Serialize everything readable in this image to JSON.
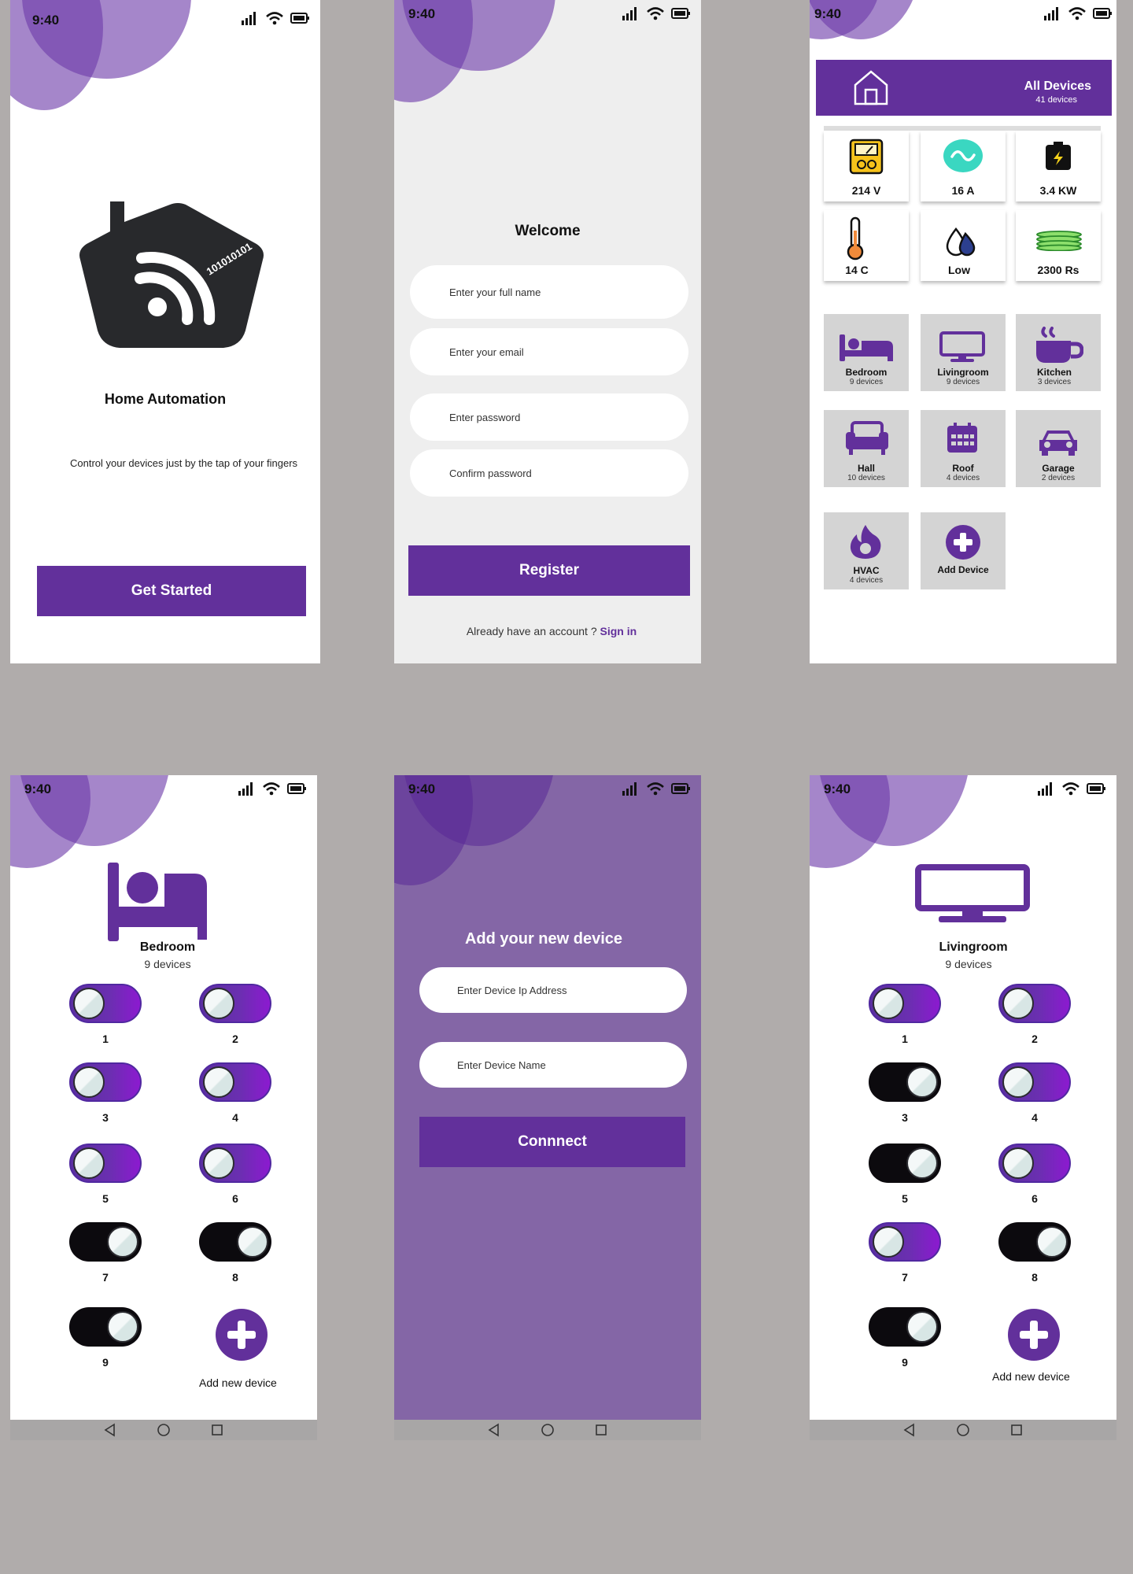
{
  "status_time": "9:40",
  "colors": {
    "accent": "#62309b",
    "toggle_on": "#6a2fb0",
    "toggle_off": "#0c0a0e",
    "background": "#b0acab",
    "light_screen": "#eeeeee",
    "purple_screen": "#8466a6"
  },
  "splash": {
    "title": "Home Automation",
    "subtitle": "Control your devices just by the tap of your fingers",
    "binary_text": "101010101",
    "cta": "Get Started"
  },
  "register": {
    "title": "Welcome",
    "full_name_placeholder": "Enter your full name",
    "email_placeholder": "Enter your email",
    "password_placeholder": "Enter password",
    "confirm_placeholder": "Confirm password",
    "submit": "Register",
    "signin_prompt": "Already have an account ?",
    "signin_link": "Sign in"
  },
  "dashboard": {
    "header_title": "All Devices",
    "header_count": "41 devices",
    "stats": [
      {
        "icon": "voltmeter-icon",
        "value": "214 V"
      },
      {
        "icon": "ac-current-icon",
        "value": "16 A"
      },
      {
        "icon": "battery-icon",
        "value": "3.4 KW"
      },
      {
        "icon": "thermometer-icon",
        "value": "14 C"
      },
      {
        "icon": "water-level-icon",
        "value": "Low"
      },
      {
        "icon": "money-icon",
        "value": "2300 Rs"
      }
    ],
    "rooms": [
      {
        "icon": "bed-icon",
        "name": "Bedroom",
        "count": "9 devices"
      },
      {
        "icon": "tv-icon",
        "name": "Livingroom",
        "count": "9 devices"
      },
      {
        "icon": "cup-icon",
        "name": "Kitchen",
        "count": "3 devices"
      },
      {
        "icon": "sofa-icon",
        "name": "Hall",
        "count": "10 devices"
      },
      {
        "icon": "calendar-icon",
        "name": "Roof",
        "count": "4 devices"
      },
      {
        "icon": "car-icon",
        "name": "Garage",
        "count": "2 devices"
      },
      {
        "icon": "flame-icon",
        "name": "HVAC",
        "count": "4 devices"
      },
      {
        "icon": "plus-icon",
        "name": "Add Device",
        "count": ""
      }
    ]
  },
  "bedroom": {
    "title": "Bedroom",
    "count": "9 devices",
    "switches": [
      {
        "label": "1",
        "on": true
      },
      {
        "label": "2",
        "on": true
      },
      {
        "label": "3",
        "on": true
      },
      {
        "label": "4",
        "on": true
      },
      {
        "label": "5",
        "on": true
      },
      {
        "label": "6",
        "on": true
      },
      {
        "label": "7",
        "on": false
      },
      {
        "label": "8",
        "on": false
      },
      {
        "label": "9",
        "on": false
      }
    ],
    "add_label": "Add new device"
  },
  "add_device": {
    "title": "Add your new device",
    "ip_placeholder": "Enter Device Ip Address",
    "name_placeholder": "Enter Device Name",
    "submit": "Connnect"
  },
  "livingroom": {
    "title": "Livingroom",
    "count": "9 devices",
    "switches": [
      {
        "label": "1",
        "on": true
      },
      {
        "label": "2",
        "on": true
      },
      {
        "label": "3",
        "on": false
      },
      {
        "label": "4",
        "on": true
      },
      {
        "label": "5",
        "on": false
      },
      {
        "label": "6",
        "on": true
      },
      {
        "label": "7",
        "on": true
      },
      {
        "label": "8",
        "on": false
      },
      {
        "label": "9",
        "on": false
      }
    ],
    "add_label": "Add new device"
  }
}
